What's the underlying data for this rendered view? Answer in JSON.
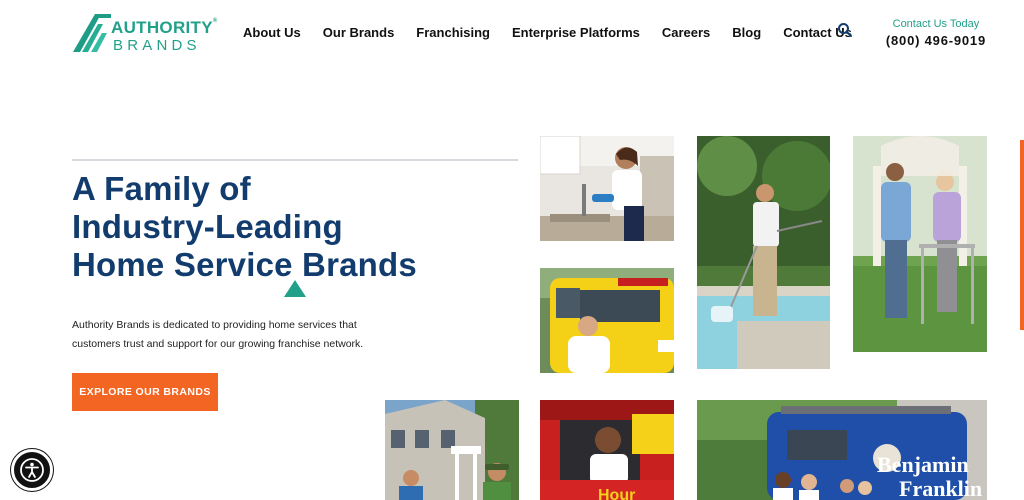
{
  "header": {
    "logo": {
      "word1": "AUTHORITY",
      "registered": "®",
      "word2": "BRANDS"
    },
    "nav": [
      "About Us",
      "Our Brands",
      "Franchising",
      "Enterprise Platforms",
      "Careers",
      "Blog",
      "Contact Us"
    ],
    "search_icon": "search-icon",
    "contact_label": "Contact Us Today",
    "contact_phone": "(800) 496-9019"
  },
  "hero": {
    "title_lines": [
      "A Family of",
      "Industry-Leading",
      "Home Service Brands"
    ],
    "description": "Authority Brands is dedicated to providing home services that customers trust and support for our growing franchise network.",
    "cta_label": "EXPLORE OUR BRANDS"
  },
  "photos": {
    "van_brand_text": [
      "Benjamin",
      "Franklin"
    ],
    "truck_text": "Hour"
  },
  "colors": {
    "brand_teal": "#22a08a",
    "heading_navy": "#123c6d",
    "cta_orange": "#f26522"
  },
  "accessibility_icon": "accessibility-icon"
}
